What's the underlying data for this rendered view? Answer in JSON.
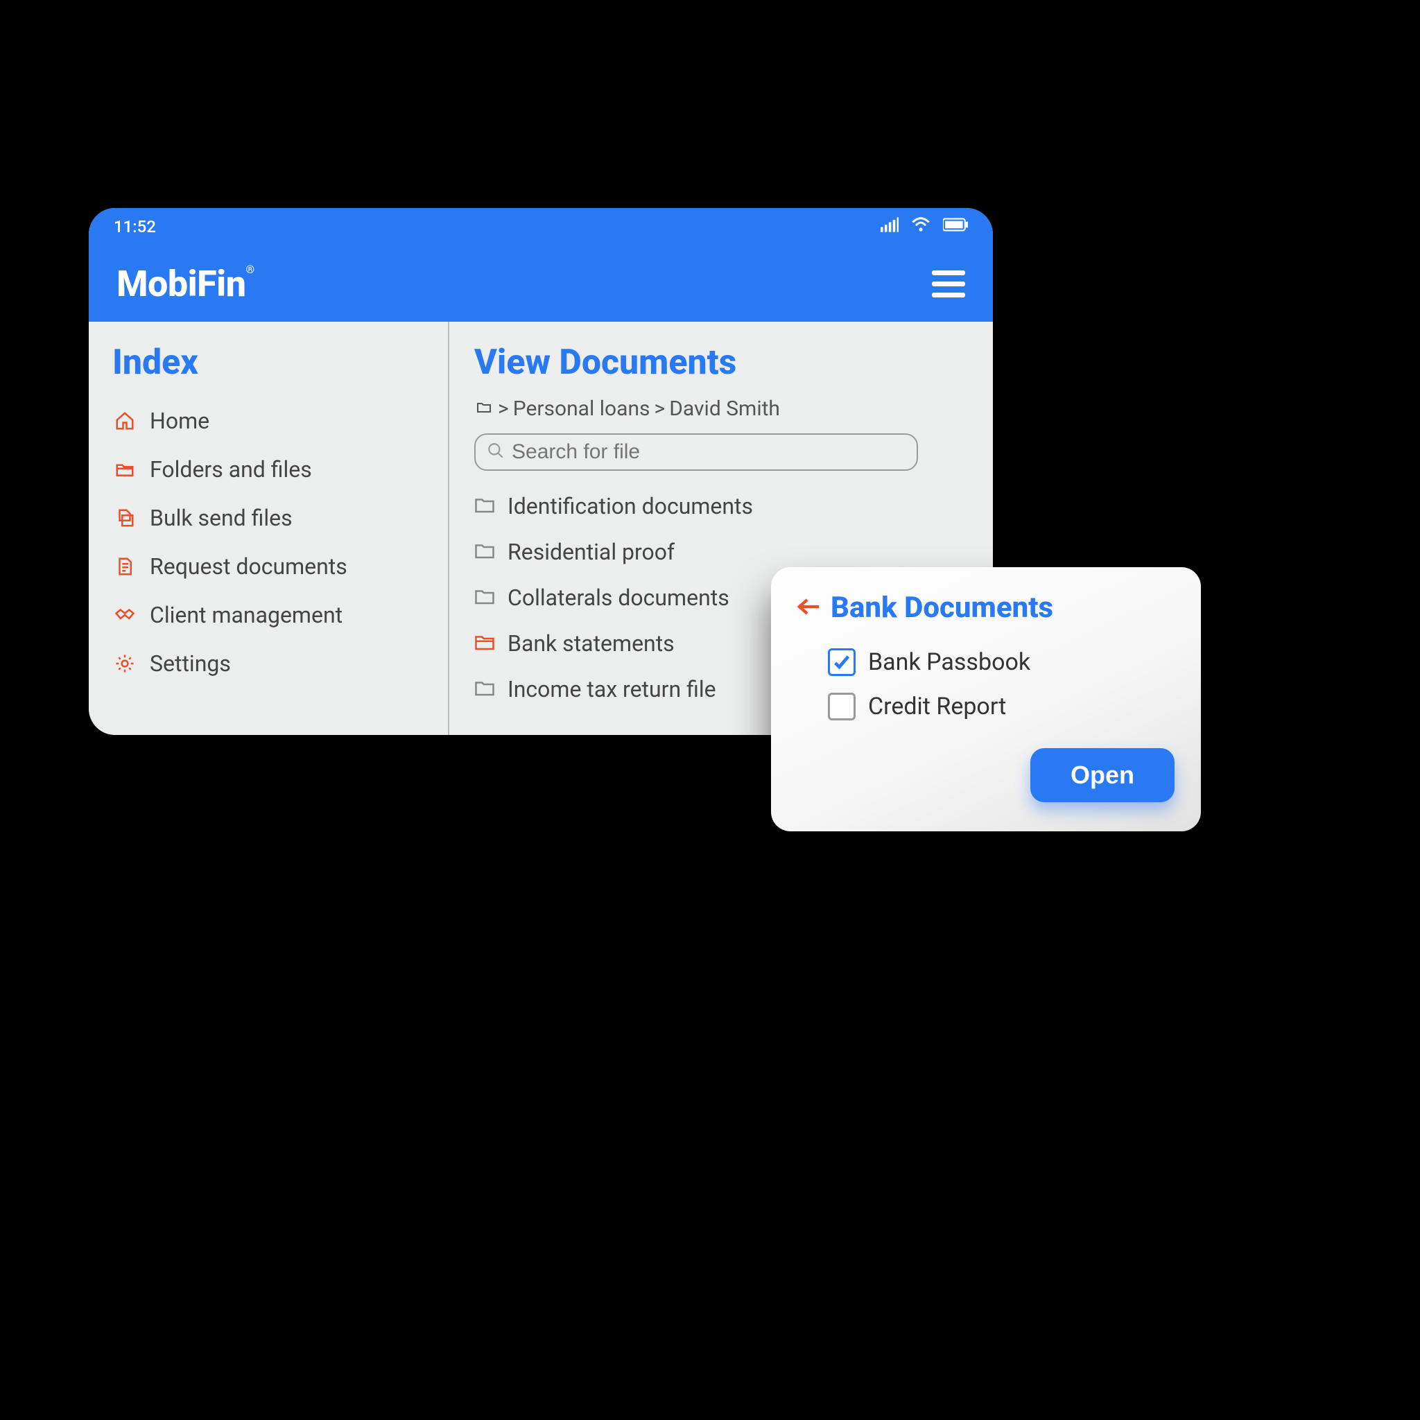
{
  "statusbar": {
    "time": "11:52"
  },
  "appbar": {
    "brand": "MobiFin"
  },
  "sidebar": {
    "title": "Index",
    "items": [
      {
        "label": "Home"
      },
      {
        "label": "Folders and files"
      },
      {
        "label": "Bulk send files"
      },
      {
        "label": "Request documents"
      },
      {
        "label": "Client management"
      },
      {
        "label": "Settings"
      }
    ]
  },
  "main": {
    "title": "View Documents",
    "breadcrumb": {
      "seg1": "Personal loans",
      "seg2": "David Smith"
    },
    "search": {
      "placeholder": "Search for file"
    },
    "folders": [
      {
        "label": "Identification documents",
        "active": false
      },
      {
        "label": "Residential proof",
        "active": false
      },
      {
        "label": "Collaterals documents",
        "active": false
      },
      {
        "label": "Bank statements",
        "active": true
      },
      {
        "label": "Income tax return file",
        "active": false
      }
    ]
  },
  "popover": {
    "title": "Bank Documents",
    "items": [
      {
        "label": "Bank Passbook",
        "checked": true
      },
      {
        "label": "Credit Report",
        "checked": false
      }
    ],
    "open_label": "Open"
  },
  "colors": {
    "primary": "#2979f3",
    "accent": "#e8502a"
  }
}
